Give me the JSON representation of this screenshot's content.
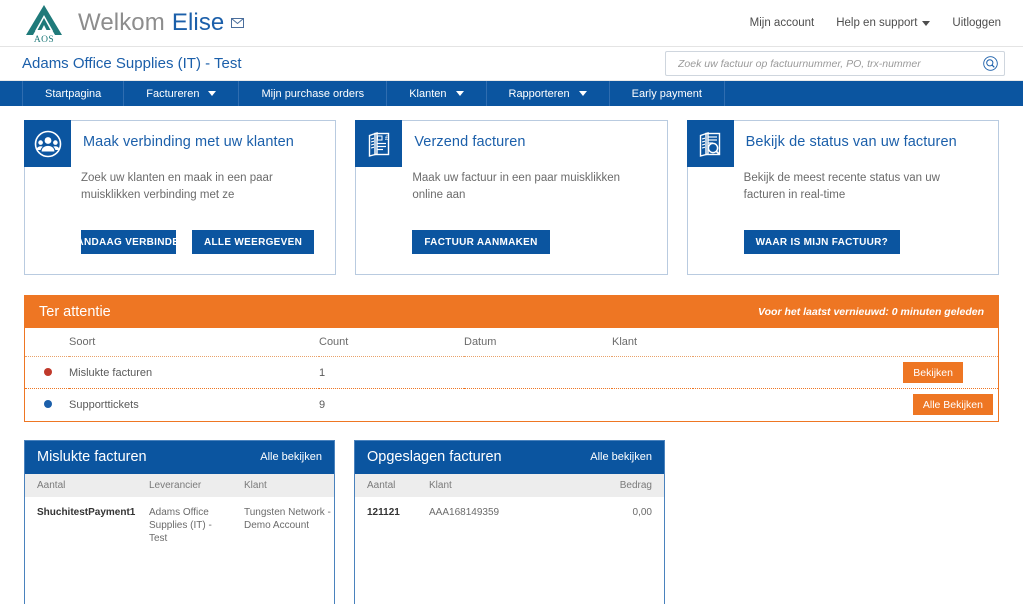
{
  "header": {
    "logo_text": "AOS",
    "welcome_prefix": "Welkom",
    "user_name": "Elise",
    "mail_icon": "envelope-icon",
    "links": [
      {
        "label": "Mijn account",
        "caret": false
      },
      {
        "label": "Help en support",
        "caret": true
      },
      {
        "label": "Uitloggen",
        "caret": false
      }
    ]
  },
  "company": {
    "name": "Adams Office Supplies (IT) - Test",
    "search_placeholder": "Zoek uw factuur op factuurnummer, PO, trx-nummer",
    "search_value": "",
    "search_icon": "search-icon"
  },
  "nav": {
    "items": [
      {
        "label": "Startpagina",
        "caret": false
      },
      {
        "label": "Factureren",
        "caret": true
      },
      {
        "label": "Mijn purchase orders",
        "caret": false
      },
      {
        "label": "Klanten",
        "caret": true
      },
      {
        "label": "Rapporteren",
        "caret": true
      },
      {
        "label": "Early payment",
        "caret": false
      }
    ]
  },
  "cards": [
    {
      "icon": "customers-circle-icon",
      "title": "Maak verbinding met uw klanten",
      "desc": "Zoek uw klanten en maak in een paar muisklikken verbinding met ze",
      "buttons": [
        {
          "label": "VANDAAG VERBINDEN"
        },
        {
          "label": "ALLE WEERGEVEN"
        }
      ]
    },
    {
      "icon": "invoice-stack-icon",
      "title": "Verzend facturen",
      "desc": "Maak uw factuur in een paar muisklikken online aan",
      "buttons": [
        {
          "label": "FACTUUR AANMAKEN"
        }
      ]
    },
    {
      "icon": "invoice-search-icon",
      "title": "Bekijk de status van uw facturen",
      "desc": "Bekijk de meest recente status van uw facturen in real-time",
      "buttons": [
        {
          "label": "WAAR IS MIJN FACTUUR?"
        }
      ]
    }
  ],
  "attention": {
    "title": "Ter attentie",
    "refresh_text": "Voor het laatst vernieuwd: 0 minuten geleden",
    "columns": [
      "Soort",
      "Count",
      "Datum",
      "Klant"
    ],
    "rows": [
      {
        "dot_color": "#c0392b",
        "soort": "Mislukte facturen",
        "count": "1",
        "datum": "",
        "klant": "",
        "action": "Bekijken"
      },
      {
        "dot_color": "#1b5faa",
        "soort": "Supporttickets",
        "count": "9",
        "datum": "",
        "klant": "",
        "action": "Alle Bekijken"
      }
    ]
  },
  "panels": [
    {
      "title": "Mislukte facturen",
      "link": "Alle bekijken",
      "columns": [
        "Aantal",
        "Leverancier",
        "Klant"
      ],
      "rows": [
        {
          "aantal": "ShuchitestPayment1",
          "col2": "Adams Office Supplies (IT) - Test",
          "col3": "Tungsten Network - Demo Account"
        }
      ]
    },
    {
      "title": "Opgeslagen facturen",
      "link": "Alle bekijken",
      "columns": [
        "Aantal",
        "Klant",
        "Bedrag"
      ],
      "rows": [
        {
          "aantal": "121121",
          "col2": "AAA168149359",
          "col3": "0,00"
        }
      ]
    }
  ],
  "colors": {
    "brand_blue": "#0b55a0",
    "link_blue": "#1b5faa",
    "accent_orange": "#ee7623",
    "logo_teal": "#1f7a7a",
    "alert_red": "#c0392b"
  }
}
